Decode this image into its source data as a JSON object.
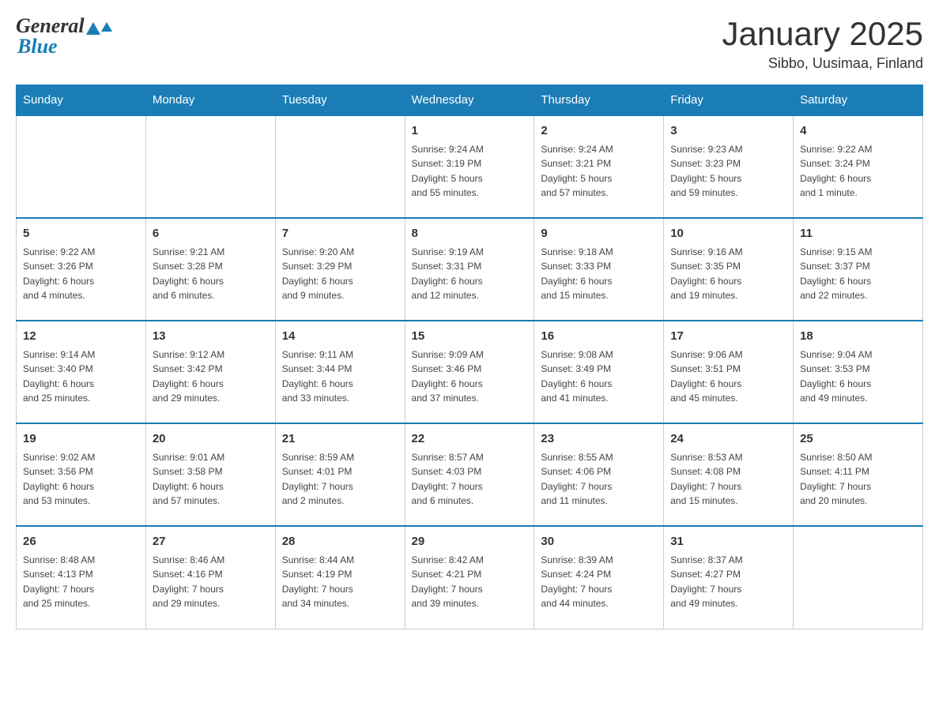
{
  "header": {
    "logo": {
      "general": "General",
      "blue": "Blue"
    },
    "title": "January 2025",
    "location": "Sibbo, Uusimaa, Finland"
  },
  "calendar": {
    "days_of_week": [
      "Sunday",
      "Monday",
      "Tuesday",
      "Wednesday",
      "Thursday",
      "Friday",
      "Saturday"
    ],
    "weeks": [
      [
        {
          "day": "",
          "info": ""
        },
        {
          "day": "",
          "info": ""
        },
        {
          "day": "",
          "info": ""
        },
        {
          "day": "1",
          "info": "Sunrise: 9:24 AM\nSunset: 3:19 PM\nDaylight: 5 hours\nand 55 minutes."
        },
        {
          "day": "2",
          "info": "Sunrise: 9:24 AM\nSunset: 3:21 PM\nDaylight: 5 hours\nand 57 minutes."
        },
        {
          "day": "3",
          "info": "Sunrise: 9:23 AM\nSunset: 3:23 PM\nDaylight: 5 hours\nand 59 minutes."
        },
        {
          "day": "4",
          "info": "Sunrise: 9:22 AM\nSunset: 3:24 PM\nDaylight: 6 hours\nand 1 minute."
        }
      ],
      [
        {
          "day": "5",
          "info": "Sunrise: 9:22 AM\nSunset: 3:26 PM\nDaylight: 6 hours\nand 4 minutes."
        },
        {
          "day": "6",
          "info": "Sunrise: 9:21 AM\nSunset: 3:28 PM\nDaylight: 6 hours\nand 6 minutes."
        },
        {
          "day": "7",
          "info": "Sunrise: 9:20 AM\nSunset: 3:29 PM\nDaylight: 6 hours\nand 9 minutes."
        },
        {
          "day": "8",
          "info": "Sunrise: 9:19 AM\nSunset: 3:31 PM\nDaylight: 6 hours\nand 12 minutes."
        },
        {
          "day": "9",
          "info": "Sunrise: 9:18 AM\nSunset: 3:33 PM\nDaylight: 6 hours\nand 15 minutes."
        },
        {
          "day": "10",
          "info": "Sunrise: 9:16 AM\nSunset: 3:35 PM\nDaylight: 6 hours\nand 19 minutes."
        },
        {
          "day": "11",
          "info": "Sunrise: 9:15 AM\nSunset: 3:37 PM\nDaylight: 6 hours\nand 22 minutes."
        }
      ],
      [
        {
          "day": "12",
          "info": "Sunrise: 9:14 AM\nSunset: 3:40 PM\nDaylight: 6 hours\nand 25 minutes."
        },
        {
          "day": "13",
          "info": "Sunrise: 9:12 AM\nSunset: 3:42 PM\nDaylight: 6 hours\nand 29 minutes."
        },
        {
          "day": "14",
          "info": "Sunrise: 9:11 AM\nSunset: 3:44 PM\nDaylight: 6 hours\nand 33 minutes."
        },
        {
          "day": "15",
          "info": "Sunrise: 9:09 AM\nSunset: 3:46 PM\nDaylight: 6 hours\nand 37 minutes."
        },
        {
          "day": "16",
          "info": "Sunrise: 9:08 AM\nSunset: 3:49 PM\nDaylight: 6 hours\nand 41 minutes."
        },
        {
          "day": "17",
          "info": "Sunrise: 9:06 AM\nSunset: 3:51 PM\nDaylight: 6 hours\nand 45 minutes."
        },
        {
          "day": "18",
          "info": "Sunrise: 9:04 AM\nSunset: 3:53 PM\nDaylight: 6 hours\nand 49 minutes."
        }
      ],
      [
        {
          "day": "19",
          "info": "Sunrise: 9:02 AM\nSunset: 3:56 PM\nDaylight: 6 hours\nand 53 minutes."
        },
        {
          "day": "20",
          "info": "Sunrise: 9:01 AM\nSunset: 3:58 PM\nDaylight: 6 hours\nand 57 minutes."
        },
        {
          "day": "21",
          "info": "Sunrise: 8:59 AM\nSunset: 4:01 PM\nDaylight: 7 hours\nand 2 minutes."
        },
        {
          "day": "22",
          "info": "Sunrise: 8:57 AM\nSunset: 4:03 PM\nDaylight: 7 hours\nand 6 minutes."
        },
        {
          "day": "23",
          "info": "Sunrise: 8:55 AM\nSunset: 4:06 PM\nDaylight: 7 hours\nand 11 minutes."
        },
        {
          "day": "24",
          "info": "Sunrise: 8:53 AM\nSunset: 4:08 PM\nDaylight: 7 hours\nand 15 minutes."
        },
        {
          "day": "25",
          "info": "Sunrise: 8:50 AM\nSunset: 4:11 PM\nDaylight: 7 hours\nand 20 minutes."
        }
      ],
      [
        {
          "day": "26",
          "info": "Sunrise: 8:48 AM\nSunset: 4:13 PM\nDaylight: 7 hours\nand 25 minutes."
        },
        {
          "day": "27",
          "info": "Sunrise: 8:46 AM\nSunset: 4:16 PM\nDaylight: 7 hours\nand 29 minutes."
        },
        {
          "day": "28",
          "info": "Sunrise: 8:44 AM\nSunset: 4:19 PM\nDaylight: 7 hours\nand 34 minutes."
        },
        {
          "day": "29",
          "info": "Sunrise: 8:42 AM\nSunset: 4:21 PM\nDaylight: 7 hours\nand 39 minutes."
        },
        {
          "day": "30",
          "info": "Sunrise: 8:39 AM\nSunset: 4:24 PM\nDaylight: 7 hours\nand 44 minutes."
        },
        {
          "day": "31",
          "info": "Sunrise: 8:37 AM\nSunset: 4:27 PM\nDaylight: 7 hours\nand 49 minutes."
        },
        {
          "day": "",
          "info": ""
        }
      ]
    ]
  }
}
